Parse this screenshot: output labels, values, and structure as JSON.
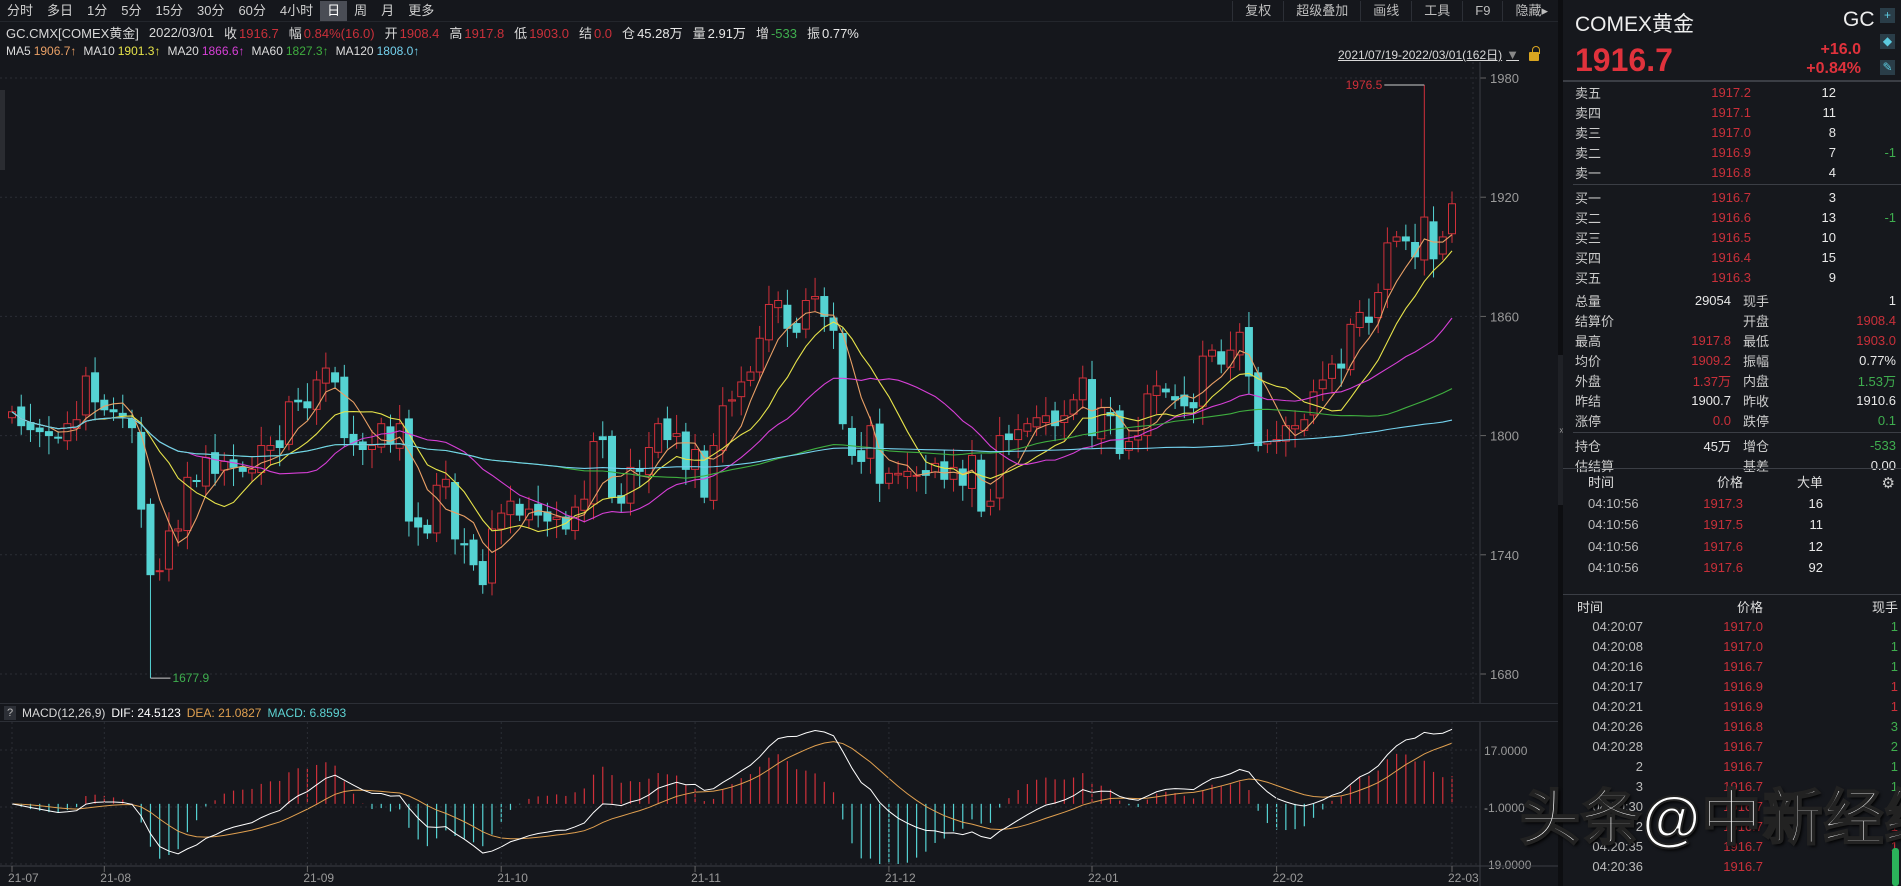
{
  "toolbar": {
    "periods": [
      "分时",
      "多日",
      "1分",
      "5分",
      "15分",
      "30分",
      "60分",
      "4小时",
      "日",
      "周",
      "月",
      "更多"
    ],
    "selected": "日",
    "tools": [
      "复权",
      "超级叠加",
      "画线",
      "工具",
      "F9",
      "隐藏▸"
    ]
  },
  "info": {
    "symbol": "GC.CMX[COMEX黄金]",
    "date": "2022/03/01",
    "items": [
      {
        "label": "收",
        "value": "1916.7",
        "color": "red"
      },
      {
        "label": "幅",
        "value": "0.84%(16.0)",
        "color": "red"
      },
      {
        "label": "开",
        "value": "1908.4",
        "color": "red"
      },
      {
        "label": "高",
        "value": "1917.8",
        "color": "red"
      },
      {
        "label": "低",
        "value": "1903.0",
        "color": "red"
      },
      {
        "label": "结",
        "value": "0.0",
        "color": "red"
      },
      {
        "label": "仓",
        "value": "45.28万",
        "color": "white"
      },
      {
        "label": "量",
        "value": "2.91万",
        "color": "white"
      },
      {
        "label": "增",
        "value": "-533",
        "color": "green"
      },
      {
        "label": "振",
        "value": "0.77%",
        "color": "white"
      }
    ]
  },
  "ma_legend": [
    {
      "name": "MA5",
      "value": "1906.7↑",
      "color": "#e9a066"
    },
    {
      "name": "MA10",
      "value": "1901.3↑",
      "color": "#e6e34a"
    },
    {
      "name": "MA20",
      "value": "1866.6↑",
      "color": "#d63fd6"
    },
    {
      "name": "MA60",
      "value": "1827.3↑",
      "color": "#3fae3f"
    },
    {
      "name": "MA120",
      "value": "1808.0↑",
      "color": "#74d2ee"
    }
  ],
  "range": {
    "text": "2021/07/19-2022/03/01(162日)",
    "triangle": "▼"
  },
  "macd": {
    "help": "?",
    "title": "MACD(12,26,9)",
    "dif": "DIF: 24.5123",
    "dea": "DEA: 21.0827",
    "macd": "MACD: 6.8593",
    "dif_color": "#ffffff",
    "dea_color": "#e0a050",
    "hist_color": "#5dd3d3"
  },
  "colors": {
    "up": "#d0303a",
    "down": "#55d3d3",
    "grid": "#2b2e35",
    "axis_text": "#9a9a9a"
  },
  "chart_data": {
    "type": "candlestick",
    "price_ticks": [
      1980,
      1920,
      1860,
      1800,
      1740,
      1680
    ],
    "price_range": [
      1680,
      1980
    ],
    "macd_ticks": [
      "17.0000",
      "-1.0000",
      "-19.0000"
    ],
    "macd_tick_values": [
      17,
      -1,
      -19
    ],
    "ma_periods": [
      5,
      10,
      20,
      60,
      120
    ],
    "months": [
      {
        "label": "21-07",
        "closes": [
          1812,
          1805,
          1803,
          1802,
          1800,
          1799,
          1806,
          1808,
          1830,
          1817
        ]
      },
      {
        "label": "21-08",
        "closes": [
          1813,
          1812,
          1810,
          1804,
          1763,
          1730,
          1732,
          1752,
          1753,
          1779,
          1777,
          1789,
          1781,
          1787,
          1784,
          1782,
          1783,
          1795,
          1795,
          1794,
          1817,
          1817
        ]
      },
      {
        "label": "21-09",
        "closes": [
          1814,
          1828,
          1834,
          1827,
          1799,
          1796,
          1793,
          1795,
          1806,
          1796,
          1806,
          1757,
          1754,
          1751,
          1775,
          1778,
          1748,
          1745,
          1735,
          1725,
          1753
        ]
      },
      {
        "label": "21-10",
        "closes": [
          1761,
          1767,
          1760,
          1763,
          1760,
          1757,
          1759,
          1753,
          1764,
          1768,
          1797,
          1798,
          1769,
          1766,
          1784,
          1782,
          1794,
          1806,
          1798,
          1801,
          1783
        ]
      },
      {
        "label": "21-11",
        "closes": [
          1793,
          1769,
          1795,
          1815,
          1818,
          1827,
          1832,
          1849,
          1866,
          1868,
          1854,
          1852,
          1868,
          1870,
          1860,
          1853,
          1806,
          1790,
          1787,
          1805,
          1776
        ]
      },
      {
        "label": "21-12",
        "closes": [
          1781,
          1781,
          1782,
          1780,
          1780,
          1786,
          1778,
          1784,
          1775,
          1790,
          1762,
          1767,
          1800,
          1798,
          1803,
          1806,
          1809,
          1810,
          1805,
          1810,
          1818,
          1829
        ]
      },
      {
        "label": "22-01",
        "closes": [
          1800,
          1814,
          1810,
          1791,
          1797,
          1800,
          1821,
          1825,
          1822,
          1818,
          1815,
          1814,
          1840,
          1843,
          1836,
          1843,
          1852,
          1830,
          1795,
          1797
        ]
      },
      {
        "label": "22-02",
        "closes": [
          1798,
          1805,
          1805,
          1808,
          1822,
          1828,
          1836,
          1834,
          1856,
          1862,
          1857,
          1872,
          1897,
          1900,
          1898,
          1890,
          1910,
          1889,
          1900
        ]
      },
      {
        "label": "22-03",
        "closes": [
          1916.7
        ]
      }
    ],
    "annotations": [
      {
        "text": "1976.5",
        "kind": "high",
        "value": 1976.5,
        "month": "22-02",
        "nth": 17,
        "color": "#d0303a"
      },
      {
        "text": "1677.9",
        "kind": "low",
        "value": 1677.9,
        "month": "21-08",
        "nth": 6,
        "color": "#3fae4f"
      }
    ]
  },
  "panel": {
    "title": "COMEX黄金",
    "symbol": "GC",
    "price": "1916.7",
    "change": "+16.0",
    "change_pct": "+0.84%",
    "icons": [
      "plus-icon",
      "bell-icon",
      "pencil-icon"
    ],
    "sells": [
      {
        "label": "卖五",
        "price": "1917.2",
        "vol": "12",
        "chg": ""
      },
      {
        "label": "卖四",
        "price": "1917.1",
        "vol": "11",
        "chg": ""
      },
      {
        "label": "卖三",
        "price": "1917.0",
        "vol": "8",
        "chg": ""
      },
      {
        "label": "卖二",
        "price": "1916.9",
        "vol": "7",
        "chg": "-1"
      },
      {
        "label": "卖一",
        "price": "1916.8",
        "vol": "4",
        "chg": ""
      }
    ],
    "buys": [
      {
        "label": "买一",
        "price": "1916.7",
        "vol": "3",
        "chg": ""
      },
      {
        "label": "买二",
        "price": "1916.6",
        "vol": "13",
        "chg": "-1"
      },
      {
        "label": "买三",
        "price": "1916.5",
        "vol": "10",
        "chg": ""
      },
      {
        "label": "买四",
        "price": "1916.4",
        "vol": "15",
        "chg": ""
      },
      {
        "label": "买五",
        "price": "1916.3",
        "vol": "9",
        "chg": ""
      }
    ],
    "stats": [
      {
        "l1": "总量",
        "v1": "29054",
        "c1": "white",
        "l2": "现手",
        "v2": "1",
        "c2": "white"
      },
      {
        "l1": "结算价",
        "v1": "",
        "c1": "white",
        "l2": "开盘",
        "v2": "1908.4",
        "c2": "dred"
      },
      {
        "l1": "最高",
        "v1": "1917.8",
        "c1": "dred",
        "l2": "最低",
        "v2": "1903.0",
        "c2": "dred"
      },
      {
        "l1": "均价",
        "v1": "1909.2",
        "c1": "dred",
        "l2": "振幅",
        "v2": "0.77%",
        "c2": "white"
      },
      {
        "l1": "外盘",
        "v1": "1.37万",
        "c1": "dred",
        "l2": "内盘",
        "v2": "1.53万",
        "c2": "green"
      },
      {
        "l1": "昨结",
        "v1": "1900.7",
        "c1": "white",
        "l2": "昨收",
        "v2": "1910.6",
        "c2": "white"
      },
      {
        "l1": "涨停",
        "v1": "0.0",
        "c1": "dred",
        "l2": "跌停",
        "v2": "0.1",
        "c2": "green"
      },
      {
        "l1": "持仓",
        "v1": "45万",
        "c1": "white",
        "l2": "增仓",
        "v2": "-533",
        "c2": "green"
      },
      {
        "l1": "估结算",
        "v1": "",
        "c1": "white",
        "l2": "基差",
        "v2": "0.00",
        "c2": "white"
      }
    ],
    "big_orders": {
      "headers": [
        "时间",
        "价格",
        "大单"
      ],
      "rows": [
        [
          "04:10:56",
          "1917.3",
          "16"
        ],
        [
          "04:10:56",
          "1917.5",
          "11"
        ],
        [
          "04:10:56",
          "1917.6",
          "12"
        ],
        [
          "04:10:56",
          "1917.6",
          "92"
        ]
      ]
    },
    "trades": {
      "headers": [
        "时间",
        "价格",
        "现手"
      ],
      "rows": [
        {
          "t": "04:20:07",
          "p": "1917.0",
          "v": "1",
          "c": "green"
        },
        {
          "t": "04:20:08",
          "p": "1917.0",
          "v": "1",
          "c": "green"
        },
        {
          "t": "04:20:16",
          "p": "1916.7",
          "v": "1",
          "c": "green"
        },
        {
          "t": "04:20:17",
          "p": "1916.9",
          "v": "1",
          "c": "dred"
        },
        {
          "t": "04:20:21",
          "p": "1916.9",
          "v": "1",
          "c": "dred"
        },
        {
          "t": "04:20:26",
          "p": "1916.8",
          "v": "3",
          "c": "green"
        },
        {
          "t": "04:20:28",
          "p": "1916.7",
          "v": "2",
          "c": "green"
        },
        {
          "t": "2",
          "p": "1916.7",
          "v": "1",
          "c": "green"
        },
        {
          "t": "3",
          "p": "1916.7",
          "v": "1",
          "c": "green"
        },
        {
          "t": "04:20:30",
          "p": "1916.7",
          "v": "1",
          "c": "dred"
        },
        {
          "t": "2",
          "p": "1916.7",
          "v": "1",
          "c": "dred"
        },
        {
          "t": "04:20:35",
          "p": "1916.7",
          "v": "1",
          "c": "dred"
        },
        {
          "t": "04:20:36",
          "p": "1916.7",
          "v": "",
          "c": "dred"
        }
      ]
    }
  },
  "watermark": "头条@中新经纬"
}
